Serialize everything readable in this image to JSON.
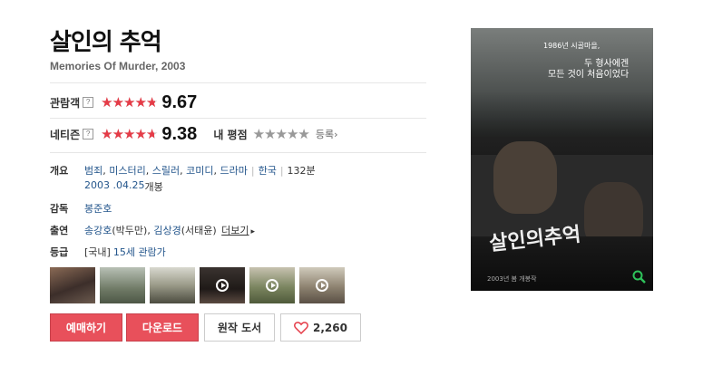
{
  "movie": {
    "title": "살인의 추억",
    "subtitle": "Memories Of Murder, 2003"
  },
  "ratings": {
    "audience": {
      "label": "관람객",
      "help": "?",
      "score": "9.67",
      "star_fraction": 0.967
    },
    "netizen": {
      "label": "네티즌",
      "help": "?",
      "score": "9.38",
      "star_fraction": 0.938
    },
    "my_rating": {
      "label": "내 평점",
      "star_fraction": 1.0,
      "register": "등록"
    }
  },
  "info": {
    "overview_label": "개요",
    "genres": [
      "범죄",
      "미스터리",
      "스릴러",
      "코미디",
      "드라마"
    ],
    "country": "한국",
    "runtime": "132분",
    "release_date": "2003 .04.25",
    "release_suffix": "개봉",
    "director_label": "감독",
    "director": "봉준호",
    "cast_label": "출연",
    "cast1": "송강호",
    "cast1_role": "(박두만),",
    "cast2": "김상경",
    "cast2_role": "(서태윤)",
    "more": "더보기",
    "grade_label": "등급",
    "grade_country": "[국내]",
    "grade": "15세 관람가"
  },
  "thumbnails": [
    {
      "has_play": false
    },
    {
      "has_play": false
    },
    {
      "has_play": false
    },
    {
      "has_play": true
    },
    {
      "has_play": true
    },
    {
      "has_play": true
    }
  ],
  "buttons": {
    "reserve": "예매하기",
    "download": "다운로드",
    "original_book": "원작 도서",
    "likes": "2,260"
  },
  "poster": {
    "tagline_year": "1986년 시골마을,",
    "tagline_1": "두 형사에겐",
    "tagline_2": "모든 것이 처음이었다",
    "poster_title": "살인의추억",
    "release_note": "2003년 봄 개봉작"
  },
  "colors": {
    "accent_red": "#e8505b",
    "star_red": "#e53b47",
    "link_blue": "#24568c"
  },
  "icons": [
    "help-icon",
    "chevron-right-icon",
    "play-icon",
    "heart-icon",
    "zoom-icon"
  ]
}
